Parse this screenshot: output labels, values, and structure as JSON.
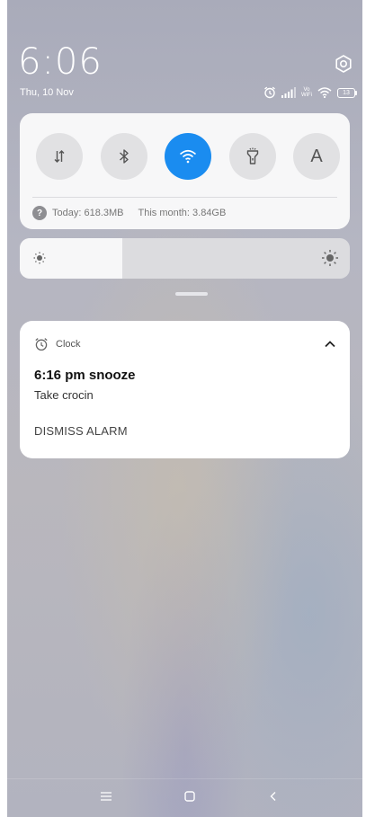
{
  "status": {
    "time": "6:06",
    "date": "Thu, 10 Nov",
    "volte_top": "Vo",
    "volte_bottom": "WiFi",
    "battery_level": "13"
  },
  "quick_settings": {
    "toggles": [
      {
        "name": "mobile-data",
        "icon": "data-arrows-icon",
        "active": false
      },
      {
        "name": "bluetooth",
        "icon": "bluetooth-icon",
        "active": false
      },
      {
        "name": "wifi",
        "icon": "wifi-icon",
        "active": true
      },
      {
        "name": "flashlight",
        "icon": "flashlight-icon",
        "active": false
      },
      {
        "name": "auto-brightness",
        "icon": "letter-a",
        "label": "A",
        "active": false
      }
    ],
    "usage_today": "Today: 618.3MB",
    "usage_month": "This month: 3.84GB",
    "help_glyph": "?"
  },
  "brightness": {
    "level": 0.31
  },
  "notification": {
    "app_name": "Clock",
    "title": "6:16 pm snooze",
    "body": "Take crocin",
    "action": "DISMISS ALARM"
  },
  "colors": {
    "accent": "#1a8cf0"
  }
}
